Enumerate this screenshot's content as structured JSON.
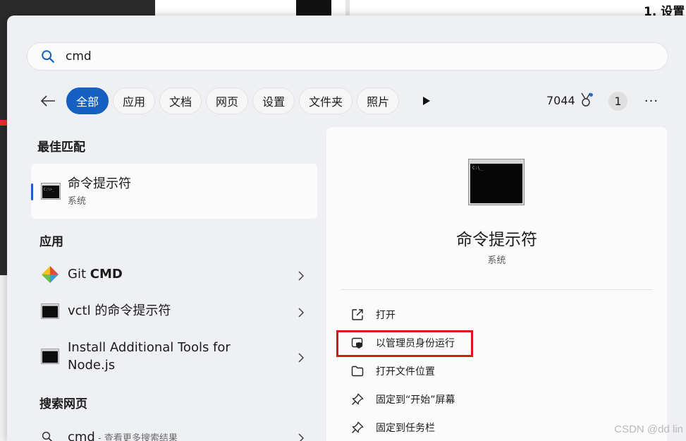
{
  "background": {
    "heading": "1. 设置"
  },
  "search": {
    "query": "cmd"
  },
  "filters": {
    "chips": [
      "全部",
      "应用",
      "文档",
      "网页",
      "设置",
      "文件夹",
      "照片"
    ]
  },
  "rewards": {
    "points": "7044",
    "count": "1",
    "more": "···"
  },
  "sections": {
    "best_match": "最佳匹配",
    "apps": "应用",
    "web": "搜索网页"
  },
  "best_match": {
    "title": "命令提示符",
    "subtitle": "系统"
  },
  "apps": [
    {
      "prefix": "Git ",
      "strong": "CMD"
    },
    {
      "title": "vctl 的命令提示符"
    },
    {
      "line1": "Install Additional Tools for",
      "line2": "Node.js"
    }
  ],
  "web_result": {
    "query": "cmd",
    "hint": " - 查看更多搜索结果"
  },
  "detail": {
    "title": "命令提示符",
    "subtitle": "系统",
    "actions": [
      "打开",
      "以管理员身份运行",
      "打开文件位置",
      "固定到“开始”屏幕",
      "固定到任务栏"
    ]
  },
  "watermark": "CSDN @dd lin",
  "colors": {
    "accent": "#1560c1",
    "highlight": "#e0141b"
  }
}
